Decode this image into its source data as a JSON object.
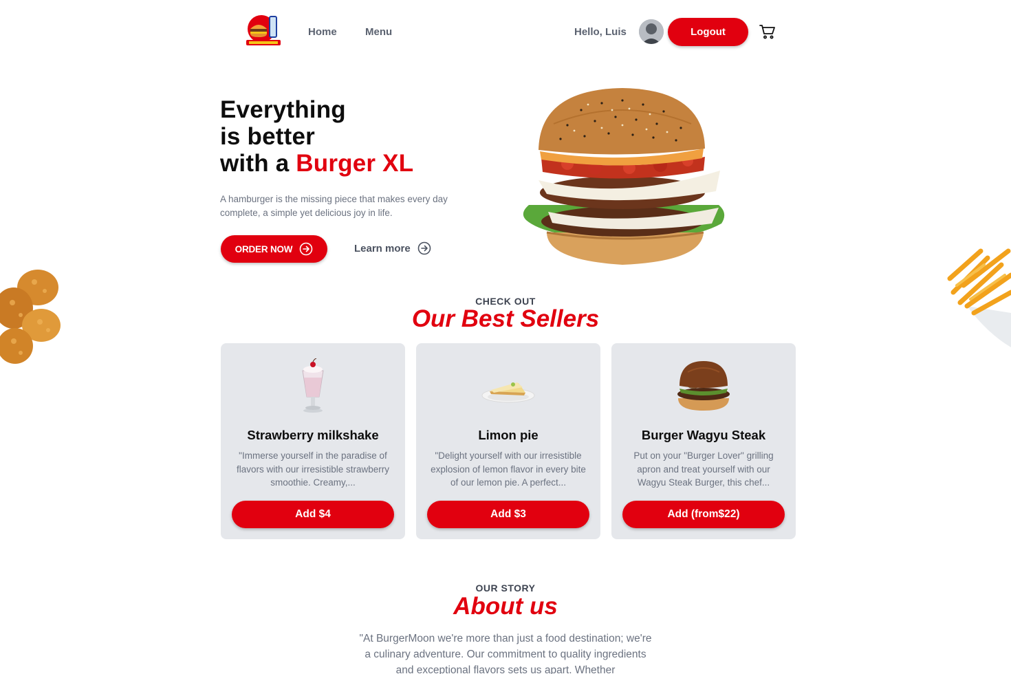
{
  "header": {
    "logo_icon": "burgermoon-logo-icon",
    "nav": {
      "home": "Home",
      "menu": "Menu"
    },
    "greeting": "Hello, Luis",
    "logout_label": "Logout",
    "cart_icon": "cart-icon"
  },
  "hero": {
    "title_line1": "Everything",
    "title_line2": "is better",
    "title_line3_prefix": "with a ",
    "title_accent": "Burger XL",
    "description": "A hamburger is the missing piece that makes every day complete, a simple yet delicious joy in life.",
    "order_label": "ORDER NOW",
    "learn_label": "Learn more"
  },
  "best_sellers": {
    "kicker": "CHECK OUT",
    "title": "Our Best Sellers",
    "items": [
      {
        "name": "Strawberry milkshake",
        "description": "\"Immerse yourself in the paradise of flavors with our irresistible strawberry smoothie. Creamy,...",
        "button": "Add $4",
        "icon": "milkshake-icon"
      },
      {
        "name": "Limon pie",
        "description": "\"Delight yourself with our irresistible explosion of lemon flavor in every bite of our lemon pie. A perfect...",
        "button": "Add $3",
        "icon": "lemon-pie-icon"
      },
      {
        "name": "Burger Wagyu Steak",
        "description": "Put on your \"Burger Lover\" grilling apron and treat yourself with our Wagyu Steak Burger, this chef...",
        "button": "Add (from$22)",
        "icon": "wagyu-burger-icon"
      }
    ]
  },
  "about": {
    "kicker": "OUR STORY",
    "title": "About us",
    "text": "\"At BurgerMoon we're more than just a food destination; we're a culinary adventure. Our commitment to quality ingredients and exceptional flavors sets us apart. Whether"
  },
  "colors": {
    "accent": "#e1000f",
    "card_bg": "#e5e7eb",
    "muted_text": "#6b7280"
  }
}
